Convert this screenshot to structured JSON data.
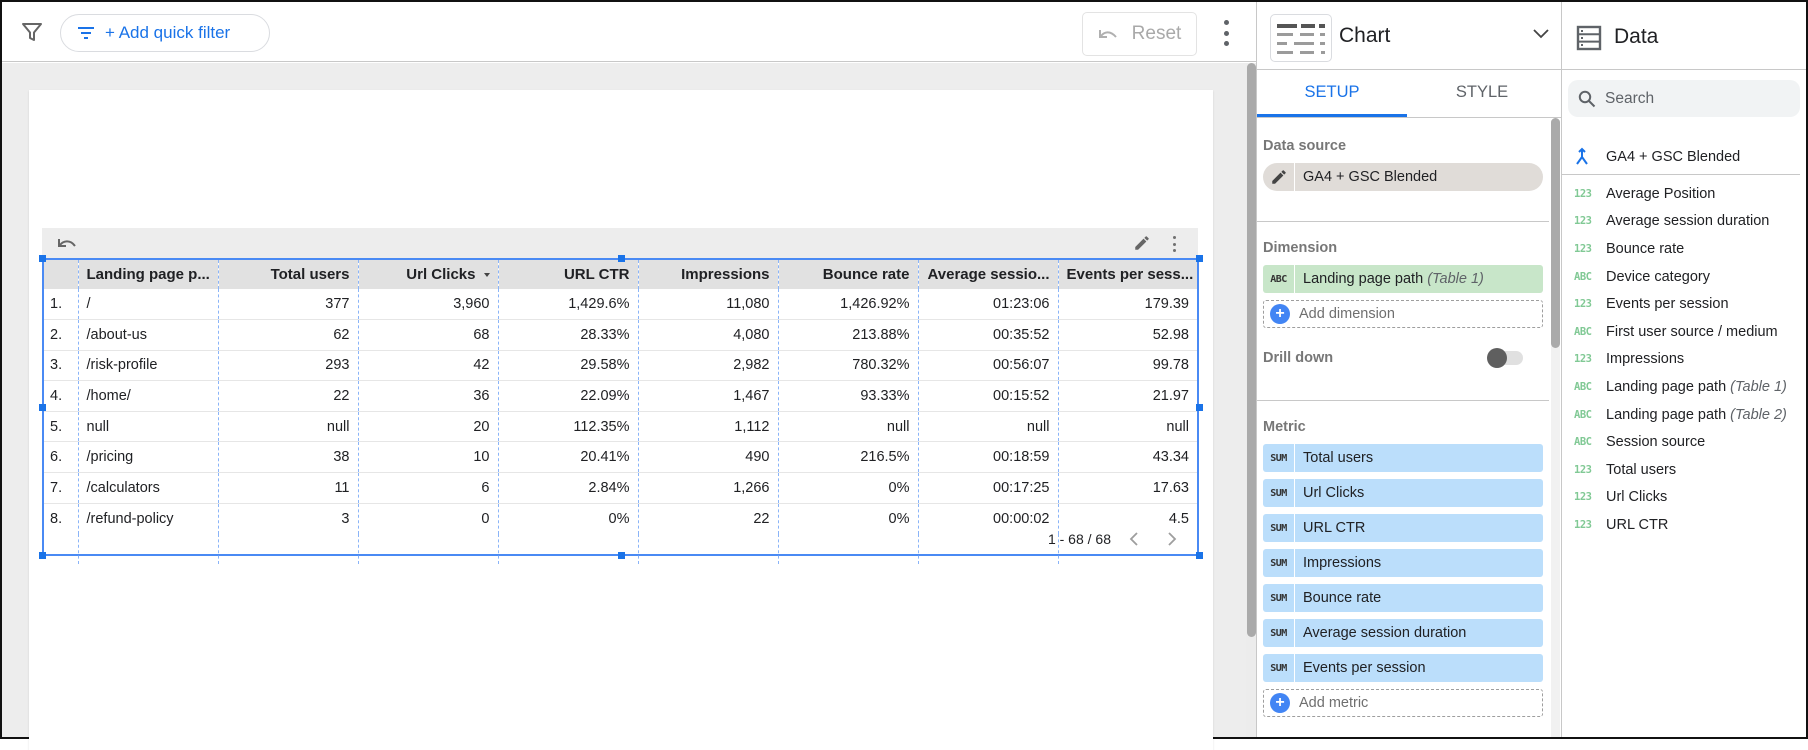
{
  "toolbar": {
    "filter_icon": "filter-icon",
    "quick_filter_label": "+ Add quick filter",
    "reset_label": "Reset",
    "more_icon": "more-vert-icon"
  },
  "table": {
    "columns": [
      "",
      "Landing page p...",
      "Total users",
      "Url Clicks",
      "URL CTR",
      "Impressions",
      "Bounce rate",
      "Average sessio...",
      "Events per sess..."
    ],
    "sorted_column": "Url Clicks",
    "sort_direction": "descending",
    "rows": [
      [
        "1.",
        "/",
        "377",
        "3,960",
        "1,429.6%",
        "11,080",
        "1,426.92%",
        "01:23:06",
        "179.39"
      ],
      [
        "2.",
        "/about-us",
        "62",
        "68",
        "28.33%",
        "4,080",
        "213.88%",
        "00:35:52",
        "52.98"
      ],
      [
        "3.",
        "/risk-profile",
        "293",
        "42",
        "29.58%",
        "2,982",
        "780.32%",
        "00:56:07",
        "99.78"
      ],
      [
        "4.",
        "/home/",
        "22",
        "36",
        "22.09%",
        "1,467",
        "93.33%",
        "00:15:52",
        "21.97"
      ],
      [
        "5.",
        "null",
        "null",
        "20",
        "112.35%",
        "1,112",
        "null",
        "null",
        "null"
      ],
      [
        "6.",
        "/pricing",
        "38",
        "10",
        "20.41%",
        "490",
        "216.5%",
        "00:18:59",
        "43.34"
      ],
      [
        "7.",
        "/calculators",
        "11",
        "6",
        "2.84%",
        "1,266",
        "0%",
        "00:17:25",
        "17.63"
      ],
      [
        "8.",
        "/refund-policy",
        "3",
        "0",
        "0%",
        "22",
        "0%",
        "00:00:02",
        "4.5"
      ]
    ],
    "pagination": "1 - 68 / 68"
  },
  "properties": {
    "title": "Chart",
    "tabs": [
      "SETUP",
      "STYLE"
    ],
    "active_tab": "SETUP",
    "data_source_label": "Data source",
    "data_source": "GA4 + GSC Blended",
    "dimension_label": "Dimension",
    "dimension": {
      "type": "ABC",
      "name": "Landing page path",
      "qualifier": "(Table 1)"
    },
    "add_dimension": "Add dimension",
    "drill_down_label": "Drill down",
    "drill_down_enabled": false,
    "metric_label": "Metric",
    "metrics": [
      {
        "agg": "SUM",
        "name": "Total users"
      },
      {
        "agg": "SUM",
        "name": "Url Clicks"
      },
      {
        "agg": "SUM",
        "name": "URL CTR"
      },
      {
        "agg": "SUM",
        "name": "Impressions"
      },
      {
        "agg": "SUM",
        "name": "Bounce rate"
      },
      {
        "agg": "SUM",
        "name": "Average session duration"
      },
      {
        "agg": "SUM",
        "name": "Events per session"
      }
    ],
    "add_metric": "Add metric"
  },
  "data_panel": {
    "title": "Data",
    "search_placeholder": "Search",
    "blend_name": "GA4 + GSC Blended",
    "fields": [
      {
        "type": "123",
        "name": "Average Position",
        "qualifier": ""
      },
      {
        "type": "123",
        "name": "Average session duration",
        "qualifier": ""
      },
      {
        "type": "123",
        "name": "Bounce rate",
        "qualifier": ""
      },
      {
        "type": "ABC",
        "name": "Device category",
        "qualifier": ""
      },
      {
        "type": "123",
        "name": "Events per session",
        "qualifier": ""
      },
      {
        "type": "ABC",
        "name": "First user source / medium",
        "qualifier": ""
      },
      {
        "type": "123",
        "name": "Impressions",
        "qualifier": ""
      },
      {
        "type": "ABC",
        "name": "Landing page path",
        "qualifier": "(Table 1)"
      },
      {
        "type": "ABC",
        "name": "Landing page path",
        "qualifier": "(Table 2)"
      },
      {
        "type": "ABC",
        "name": "Session source",
        "qualifier": ""
      },
      {
        "type": "123",
        "name": "Total users",
        "qualifier": ""
      },
      {
        "type": "123",
        "name": "Url Clicks",
        "qualifier": ""
      },
      {
        "type": "123",
        "name": "URL CTR",
        "qualifier": ""
      }
    ]
  },
  "colors": {
    "accent": "#1a73e8",
    "dimension_chip": "#c8e6c9",
    "metric_chip": "#bbdefb",
    "field_type": "#81c995"
  }
}
